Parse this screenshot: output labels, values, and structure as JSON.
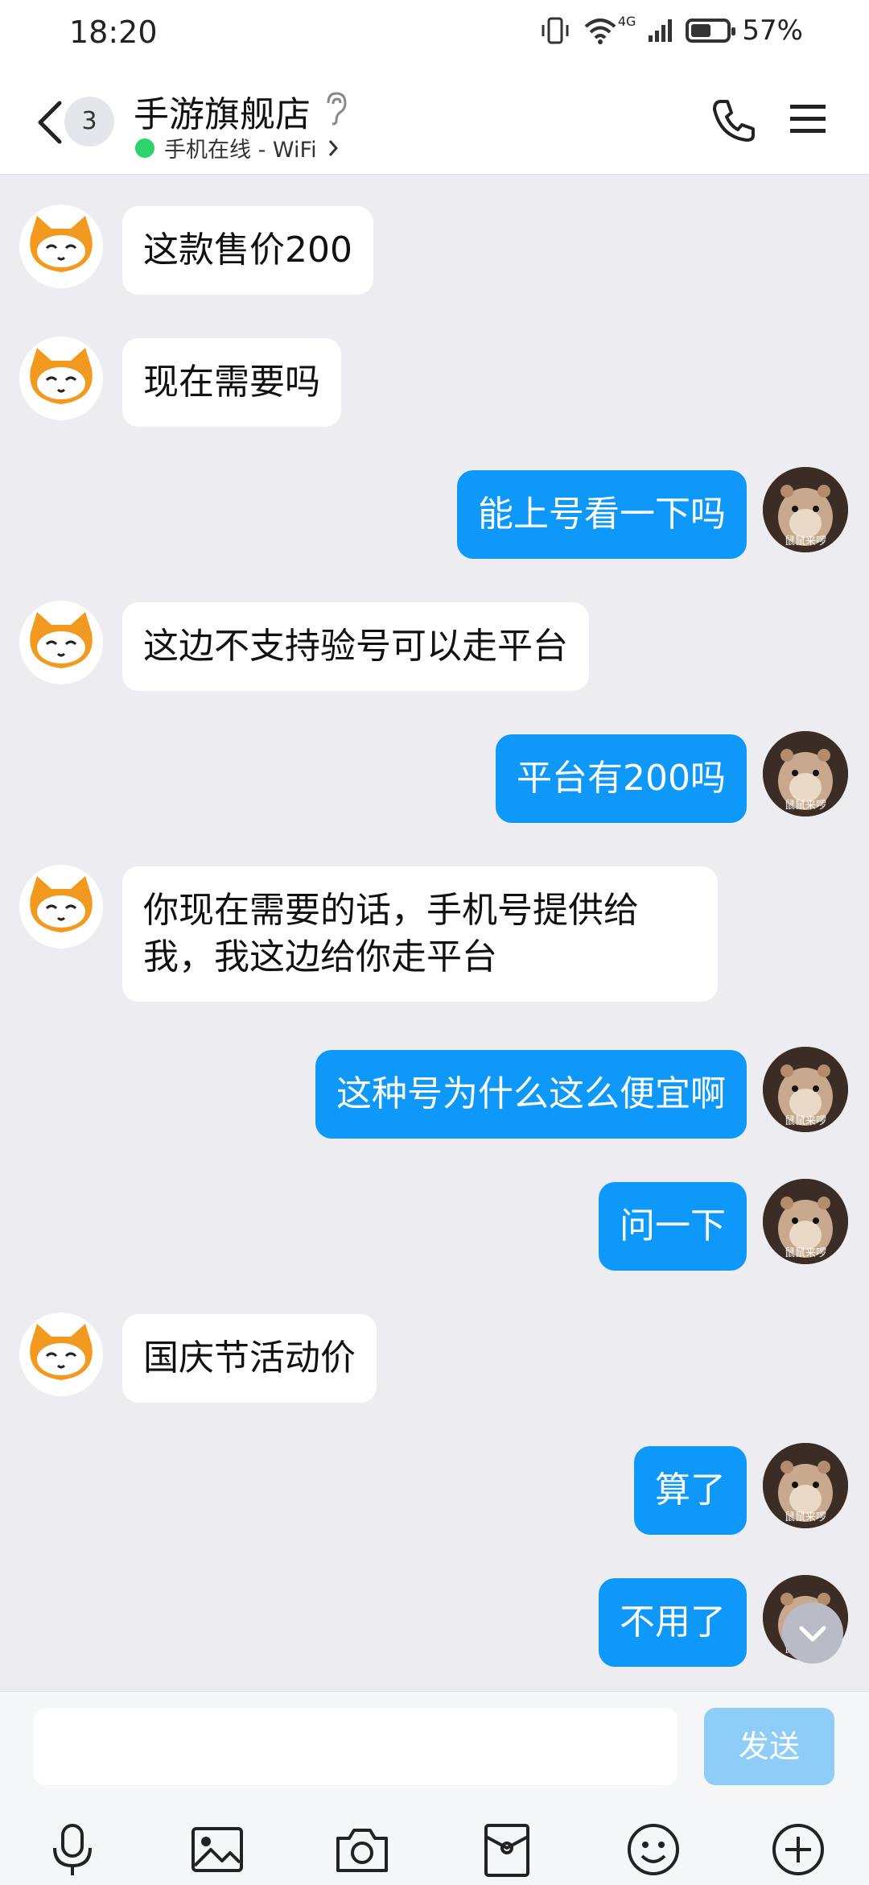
{
  "status_bar": {
    "time": "18:20",
    "battery": "57%",
    "network": "4G",
    "battery_level": 0.57
  },
  "header": {
    "unread_count": "3",
    "title": "手游旗舰店",
    "subtitle": "手机在线 - WiFi",
    "colors": {
      "online": "#2fd36b"
    }
  },
  "messages": [
    {
      "side": "in",
      "text": "这款售价200"
    },
    {
      "side": "in",
      "text": "现在需要吗"
    },
    {
      "side": "out",
      "text": "能上号看一下吗"
    },
    {
      "side": "in",
      "text": "这边不支持验号可以走平台"
    },
    {
      "side": "out",
      "text": "平台有200吗"
    },
    {
      "side": "in",
      "text": "你现在需要的话，手机号提供给我，我这边给你走平台"
    },
    {
      "side": "out",
      "text": "这种号为什么这么便宜啊"
    },
    {
      "side": "out",
      "text": "问一下"
    },
    {
      "side": "in",
      "text": "国庆节活动价"
    },
    {
      "side": "out",
      "text": "算了"
    },
    {
      "side": "out",
      "text": "不用了"
    }
  ],
  "avatar_right_caption": "鼠鼠来啰",
  "input": {
    "placeholder": "",
    "send_label": "发送"
  },
  "toolbar": [
    "microphone-icon",
    "image-icon",
    "camera-icon",
    "red-packet-icon",
    "emoji-icon",
    "plus-icon"
  ],
  "colors": {
    "outgoing": "#0e98f9",
    "incoming": "#ffffff",
    "background": "#ececf1"
  }
}
